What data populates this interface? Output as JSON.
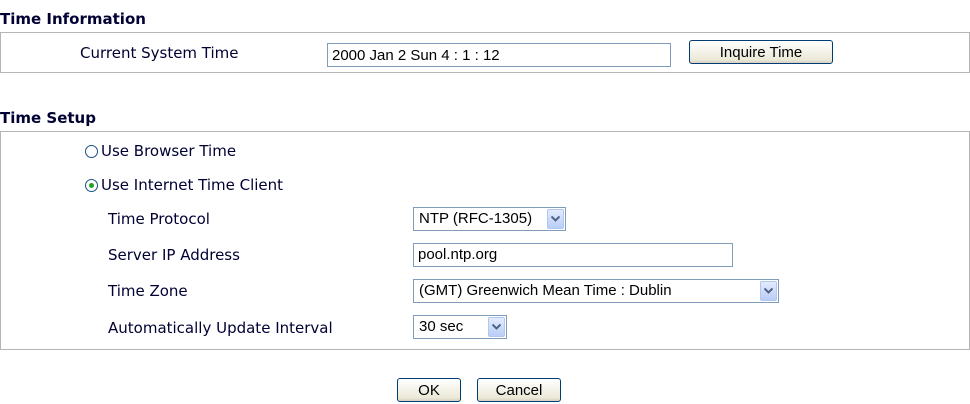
{
  "time_information": {
    "title": "Time Information",
    "current_system_time_label": "Current System Time",
    "current_system_time_value": "2000 Jan 2 Sun 4 : 1 : 12",
    "inquire_button": "Inquire Time"
  },
  "time_setup": {
    "title": "Time Setup",
    "radio_browser_label": "Use Browser Time",
    "radio_browser_selected": false,
    "radio_internet_label": "Use Internet Time Client",
    "radio_internet_selected": true,
    "protocol_label": "Time Protocol",
    "protocol_value": "NTP (RFC-1305)",
    "server_label": "Server IP Address",
    "server_value": "pool.ntp.org",
    "zone_label": "Time Zone",
    "zone_value": "(GMT) Greenwich Mean Time : Dublin",
    "interval_label": "Automatically Update Interval",
    "interval_value": "30 sec"
  },
  "actions": {
    "ok_label": "OK",
    "cancel_label": "Cancel"
  },
  "icons": {
    "dropdown": "chevron-down-icon",
    "radio_selected_color": "#21a121"
  }
}
